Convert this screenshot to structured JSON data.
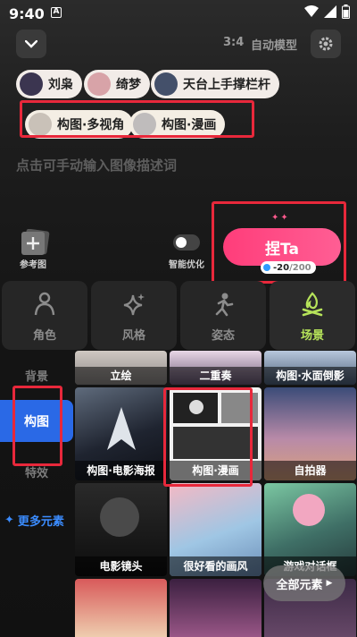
{
  "status_bar": {
    "time": "9:40",
    "a_badge": "A"
  },
  "header": {
    "ratio": "3:4",
    "model": "自动模型"
  },
  "characters": [
    {
      "name": "刘枭",
      "avatar_color": "#3b3550"
    },
    {
      "name": "绮梦",
      "avatar_color": "#d8a3a8"
    },
    {
      "name": "天台上手撑栏杆",
      "avatar_color": "#44506a"
    }
  ],
  "composition_tags": [
    {
      "label": "构图·多视角"
    },
    {
      "label": "构图·漫画"
    }
  ],
  "prompt_placeholder": "点击可手动输入图像描述词",
  "tools": {
    "reference_label": "参考图",
    "smart_label": "智能优化",
    "generate_label": "捏Ta",
    "credit_used": "-20",
    "credit_total": "/200"
  },
  "tabs": [
    {
      "label": "角色"
    },
    {
      "label": "风格"
    },
    {
      "label": "姿态"
    },
    {
      "label": "场景"
    }
  ],
  "side_menu": {
    "item_bg": "背景",
    "item_active": "构图",
    "item_fx": "特效",
    "more": "更多元素"
  },
  "grid": {
    "row0": [
      "立绘",
      "二重奏",
      "构图·水面倒影"
    ],
    "row1": [
      "构图·电影海报",
      "构图·漫画",
      "自拍器"
    ],
    "row2": [
      "电影镜头",
      "很好看的画风",
      "游戏对话框"
    ]
  },
  "all_elements_label": "全部元素",
  "colors": {
    "accent_pink": "#ff3d7a",
    "accent_blue": "#2a69e6",
    "accent_green": "#b6e35a",
    "highlight_red": "#e8283b"
  }
}
